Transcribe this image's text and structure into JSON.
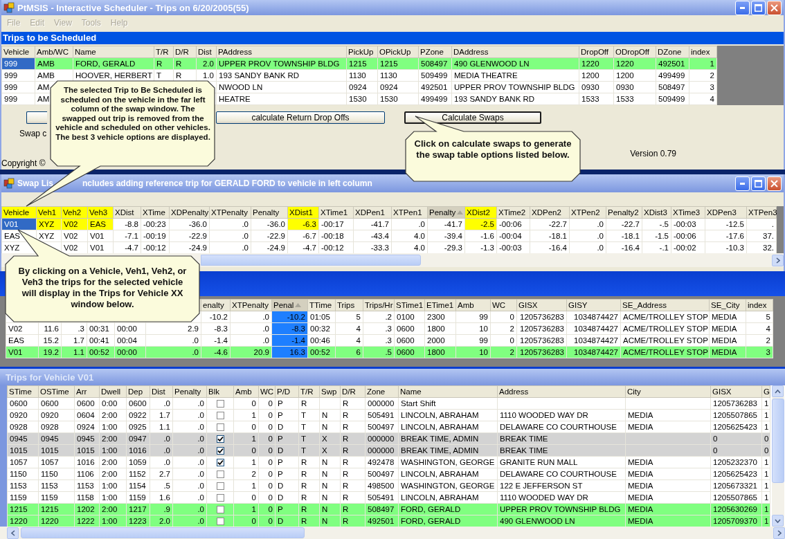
{
  "main_window": {
    "title": "PtMSIS - Interactive Scheduler - Trips on 6/20/2005(55)",
    "menu": [
      {
        "label": "File",
        "disabled": true
      },
      {
        "label": "Edit",
        "disabled": true
      },
      {
        "label": "View",
        "disabled": true
      },
      {
        "label": "Tools",
        "disabled": true
      },
      {
        "label": "Help",
        "disabled": true
      }
    ],
    "trips_panel": {
      "title": "Trips to be Scheduled",
      "columns": [
        "Vehicle",
        "Amb/WC",
        "Name",
        "T/R",
        "D/R",
        "Dist",
        "PAddress",
        "PickUp",
        "OPickUp",
        "PZone",
        "DAddress",
        "DropOff",
        "ODropOff",
        "DZone",
        "index"
      ],
      "rows": [
        {
          "selected": true,
          "kind": "highlight",
          "cells": [
            "999",
            "AMB",
            "FORD, GERALD",
            "R",
            "R",
            "2.0",
            "UPPER PROV TOWNSHIP BLDG",
            "1215",
            "1215",
            "508497",
            "490 GLENWOOD LN",
            "1220",
            "1220",
            "492501",
            "1"
          ]
        },
        {
          "selected": false,
          "kind": "normal",
          "cells": [
            "999",
            "AMB",
            "HOOVER, HERBERT",
            "T",
            "R",
            "1.0",
            "193 SANDY BANK RD",
            "1130",
            "1130",
            "509499",
            "MEDIA THEATRE",
            "1200",
            "1200",
            "499499",
            "2"
          ]
        },
        {
          "selected": false,
          "kind": "normal",
          "cells": [
            "999",
            "AM",
            null,
            null,
            null,
            null,
            "NWOOD LN",
            "0924",
            "0924",
            "492501",
            "UPPER PROV TOWNSHIP BLDG",
            "0930",
            "0930",
            "508497",
            "3"
          ]
        },
        {
          "selected": false,
          "kind": "normal",
          "cells": [
            "999",
            "AM",
            null,
            null,
            null,
            null,
            "HEATRE",
            "1530",
            "1530",
            "499499",
            "193 SANDY BANK RD",
            "1533",
            "1533",
            "509499",
            "4"
          ]
        }
      ]
    },
    "buttons": [
      "calculate Return Drop Offs",
      "Calculate Swaps"
    ],
    "swap_label": "Swap c",
    "copyright": "Copyright ©",
    "version": "Version 0.79"
  },
  "swap_window": {
    "title_parts": [
      "Swap Lis",
      "ncludes adding reference trip for GERALD FORD to vehicle in left column"
    ],
    "columns": [
      {
        "label": "Vehicle",
        "highlighted": true,
        "sorted": false
      },
      {
        "label": "Veh1",
        "highlighted": true,
        "sorted": false
      },
      {
        "label": "Veh2",
        "highlighted": true,
        "sorted": false
      },
      {
        "label": "Veh3",
        "highlighted": true,
        "sorted": false
      },
      {
        "label": "XDist",
        "highlighted": false,
        "sorted": false
      },
      {
        "label": "XTime",
        "highlighted": false,
        "sorted": false
      },
      {
        "label": "XDPenalty",
        "highlighted": false,
        "sorted": false
      },
      {
        "label": "XTPenalty",
        "highlighted": false,
        "sorted": false
      },
      {
        "label": "Penalty",
        "highlighted": false,
        "sorted": false
      },
      {
        "label": "XDist1",
        "highlighted": true,
        "sorted": false
      },
      {
        "label": "XTime1",
        "highlighted": false,
        "sorted": false
      },
      {
        "label": "XDPen1",
        "highlighted": false,
        "sorted": false
      },
      {
        "label": "XTPen1",
        "highlighted": false,
        "sorted": false
      },
      {
        "label": "Penalty",
        "highlighted": false,
        "sorted": true
      },
      {
        "label": "XDist2",
        "highlighted": true,
        "sorted": false
      },
      {
        "label": "XTime2",
        "highlighted": false,
        "sorted": false
      },
      {
        "label": "XDPen2",
        "highlighted": false,
        "sorted": false
      },
      {
        "label": "XTPen2",
        "highlighted": false,
        "sorted": false
      },
      {
        "label": "Penalty2",
        "highlighted": false,
        "sorted": false
      },
      {
        "label": "XDist3",
        "highlighted": false,
        "sorted": false
      },
      {
        "label": "XTime3",
        "highlighted": false,
        "sorted": false
      },
      {
        "label": "XDPen3",
        "highlighted": false,
        "sorted": false
      },
      {
        "label": "XTPen3",
        "highlighted": false,
        "sorted": false
      }
    ],
    "rows": [
      {
        "selected": true,
        "cells": [
          "V01",
          {
            "text": "XYZ",
            "highlighted": true
          },
          {
            "text": "V02",
            "highlighted": true
          },
          {
            "text": "EAS",
            "highlighted": true
          },
          "-8.8",
          "-00:23",
          "-36.0",
          ".0",
          "-36.0",
          {
            "text": "-6.3",
            "highlighted": true
          },
          "-00:17",
          "-41.7",
          ".0",
          "-41.7",
          {
            "text": "-2.5",
            "highlighted": true
          },
          "-00:06",
          "-22.7",
          ".0",
          "-22.7",
          "-.5",
          "-00:03",
          "-12.5",
          "."
        ]
      },
      {
        "selected": false,
        "cells": [
          "EAS",
          "XYZ",
          "V02",
          "V01",
          "-7.1",
          "-00:19",
          "-22.9",
          ".0",
          "-22.9",
          "-6.7",
          "-00:18",
          "-43.4",
          "4.0",
          "-39.4",
          "-1.6",
          "-00:04",
          "-18.1",
          ".0",
          "-18.1",
          "-1.5",
          "-00:06",
          "-17.6",
          "37."
        ]
      },
      {
        "selected": false,
        "cells": [
          "XYZ",
          null,
          "V02",
          "V01",
          "-4.7",
          "-00:12",
          "-24.9",
          ".0",
          "-24.9",
          "-4.7",
          "-00:12",
          "-33.3",
          "4.0",
          "-29.3",
          "-1.3",
          "-00:03",
          "-16.4",
          ".0",
          "-16.4",
          "-.1",
          "-00:02",
          "-10.3",
          "32."
        ]
      }
    ]
  },
  "vehicle_window": {
    "columns": [
      null,
      null,
      null,
      null,
      null,
      null,
      {
        "label": "enalty",
        "selected": false
      },
      {
        "label": "XTPenalty",
        "selected": false
      },
      {
        "label": "Penal",
        "selected": true
      },
      {
        "label": "TTime",
        "selected": false
      },
      {
        "label": "Trips",
        "selected": false
      },
      {
        "label": "Trips/Hr",
        "selected": false
      },
      {
        "label": "STime1",
        "selected": false
      },
      {
        "label": "ETime1",
        "selected": false
      },
      {
        "label": "Amb",
        "selected": false
      },
      {
        "label": "WC",
        "selected": false
      },
      {
        "label": "GISX",
        "selected": false
      },
      {
        "label": "GISY",
        "selected": false
      },
      {
        "label": "SE_Address",
        "selected": false
      },
      {
        "label": "SE_City",
        "selected": false
      },
      {
        "label": "index",
        "selected": false
      }
    ],
    "rows": [
      {
        "kind": "normal",
        "cells": [
          null,
          null,
          null,
          null,
          null,
          null,
          "-10.2",
          ".0",
          "-10.2",
          "01:05",
          "5",
          ".2",
          "0100",
          "2300",
          "99",
          "0",
          "1205736283",
          "1034874427",
          "ACME/TROLLEY STOP",
          "MEDIA",
          "5"
        ]
      },
      {
        "kind": "normal",
        "cells": [
          "V02",
          "11.6",
          ".3",
          "00:31",
          "00:00",
          "2.9",
          "-8.3",
          ".0",
          "-8.3",
          "00:32",
          "4",
          ".3",
          "0600",
          "1800",
          "10",
          "2",
          "1205736283",
          "1034874427",
          "ACME/TROLLEY STOP",
          "MEDIA",
          "4"
        ]
      },
      {
        "kind": "normal",
        "cells": [
          "EAS",
          "15.2",
          "1.7",
          "00:41",
          "00:04",
          ".0",
          "-1.4",
          ".0",
          "-1.4",
          "00:46",
          "4",
          ".3",
          "0600",
          "2000",
          "99",
          "0",
          "1205736283",
          "1034874427",
          "ACME/TROLLEY STOP",
          "MEDIA",
          "2"
        ]
      },
      {
        "kind": "highlight",
        "cells": [
          "V01",
          "19.2",
          "1.1",
          "00:52",
          "00:00",
          ".0",
          "-4.6",
          "20.9",
          "16.3",
          "00:52",
          "6",
          ".5",
          "0600",
          "1800",
          "10",
          "2",
          "1205736283",
          "1034874427",
          "ACME/TROLLEY STOP",
          "MEDIA",
          "3"
        ]
      }
    ]
  },
  "vehicle_trips_window": {
    "title": "Trips for Vehicle V01",
    "columns": [
      "STime",
      "OSTime",
      "Arr",
      "Dwell",
      "Dep",
      "Dist",
      "Penalty",
      "Blk",
      "Amb",
      "WC",
      "P/D",
      "T/R",
      "Swp",
      "D/R",
      "Zone",
      "Name",
      "Address",
      "City",
      "GISX",
      "G"
    ],
    "rows": [
      {
        "kind": "normal",
        "cells": [
          "0600",
          "0600",
          "0600",
          "0:00",
          "0600",
          ".0",
          ".0",
          {
            "checked": false
          },
          "0",
          "0",
          "P",
          "R",
          null,
          "R",
          "000000",
          "Start Shift",
          null,
          null,
          "1205736283",
          "1"
        ]
      },
      {
        "kind": "normal",
        "cells": [
          "0920",
          "0920",
          "0604",
          "2:00",
          "0922",
          "1.7",
          ".0",
          {
            "checked": false
          },
          "1",
          "0",
          "P",
          "T",
          "N",
          "R",
          "505491",
          "LINCOLN, ABRAHAM",
          "1110 WOODED WAY DR",
          "MEDIA",
          "1205507865",
          "1"
        ]
      },
      {
        "kind": "normal",
        "cells": [
          "0928",
          "0928",
          "0924",
          "1:00",
          "0925",
          "1.1",
          ".0",
          {
            "checked": false
          },
          "0",
          "0",
          "D",
          "T",
          "N",
          "R",
          "500497",
          "LINCOLN, ABRAHAM",
          "DELAWARE CO COURTHOUSE",
          "MEDIA",
          "1205625423",
          "1"
        ]
      },
      {
        "kind": "break",
        "cells": [
          "0945",
          "0945",
          "0945",
          "2:00",
          "0947",
          ".0",
          ".0",
          {
            "checked": true
          },
          "1",
          "0",
          "P",
          "T",
          "X",
          "R",
          "000000",
          "BREAK TIME, ADMIN",
          "BREAK TIME",
          null,
          "0",
          "0"
        ]
      },
      {
        "kind": "break",
        "cells": [
          "1015",
          "1015",
          "1015",
          "1:00",
          "1016",
          ".0",
          ".0",
          {
            "checked": true
          },
          "0",
          "0",
          "D",
          "T",
          "X",
          "R",
          "000000",
          "BREAK TIME, ADMIN",
          "BREAK TIME",
          null,
          "0",
          "0"
        ]
      },
      {
        "kind": "normal",
        "cells": [
          "1057",
          "1057",
          "1016",
          "2:00",
          "1059",
          ".0",
          ".0",
          {
            "checked": true
          },
          "1",
          "0",
          "P",
          "R",
          "N",
          "R",
          "492478",
          "WASHINGTON, GEORGE",
          "GRANITE RUN MALL",
          "MEDIA",
          "1205232370",
          "1"
        ]
      },
      {
        "kind": "normal",
        "cells": [
          "1150",
          "1150",
          "1106",
          "2:00",
          "1152",
          "2.7",
          ".0",
          {
            "checked": false
          },
          "2",
          "0",
          "P",
          "R",
          "N",
          "R",
          "500497",
          "LINCOLN, ABRAHAM",
          "DELAWARE CO COURTHOUSE",
          "MEDIA",
          "1205625423",
          "1"
        ]
      },
      {
        "kind": "normal",
        "cells": [
          "1153",
          "1153",
          "1153",
          "1:00",
          "1154",
          ".5",
          ".0",
          {
            "checked": false
          },
          "1",
          "0",
          "D",
          "R",
          "N",
          "R",
          "498500",
          "WASHINGTON, GEORGE",
          "122 E JEFFERSON ST",
          "MEDIA",
          "1205673321",
          "1"
        ]
      },
      {
        "kind": "normal",
        "cells": [
          "1159",
          "1159",
          "1158",
          "1:00",
          "1159",
          "1.6",
          ".0",
          {
            "checked": false
          },
          "0",
          "0",
          "D",
          "R",
          "N",
          "R",
          "505491",
          "LINCOLN, ABRAHAM",
          "1110 WOODED WAY DR",
          "MEDIA",
          "1205507865",
          "1"
        ]
      },
      {
        "kind": "highlight",
        "cells": [
          "1215",
          "1215",
          "1202",
          "2:00",
          "1217",
          ".9",
          ".0",
          {
            "checked": false
          },
          "1",
          "0",
          "P",
          "R",
          "N",
          "R",
          "508497",
          "FORD, GERALD",
          "UPPER PROV TOWNSHIP BLDG",
          "MEDIA",
          "1205630269",
          "1"
        ]
      },
      {
        "kind": "highlight",
        "cells": [
          "1220",
          "1220",
          "1222",
          "1:00",
          "1223",
          "2.0",
          ".0",
          {
            "checked": false
          },
          "0",
          "0",
          "D",
          "R",
          "N",
          "R",
          "492501",
          "FORD, GERALD",
          "490 GLENWOOD LN",
          "MEDIA",
          "1205709370",
          "1"
        ]
      }
    ]
  },
  "callouts": [
    {
      "text": "The selected Trip to Be Scheduled is scheduled on the vehicle in the far left column of the swap window. The swapped out trip is removed from the vehicle and scheduled on other vehicles. The best 3 vehicle options are displayed."
    },
    {
      "text": "By clicking on a Vehicle, Veh1, Veh2, or Veh3 the trips for the selected vehicle will display in the Trips for Vehicle XX window below."
    },
    {
      "text": "Click on calculate swaps to generate the swap table options listed below."
    }
  ]
}
